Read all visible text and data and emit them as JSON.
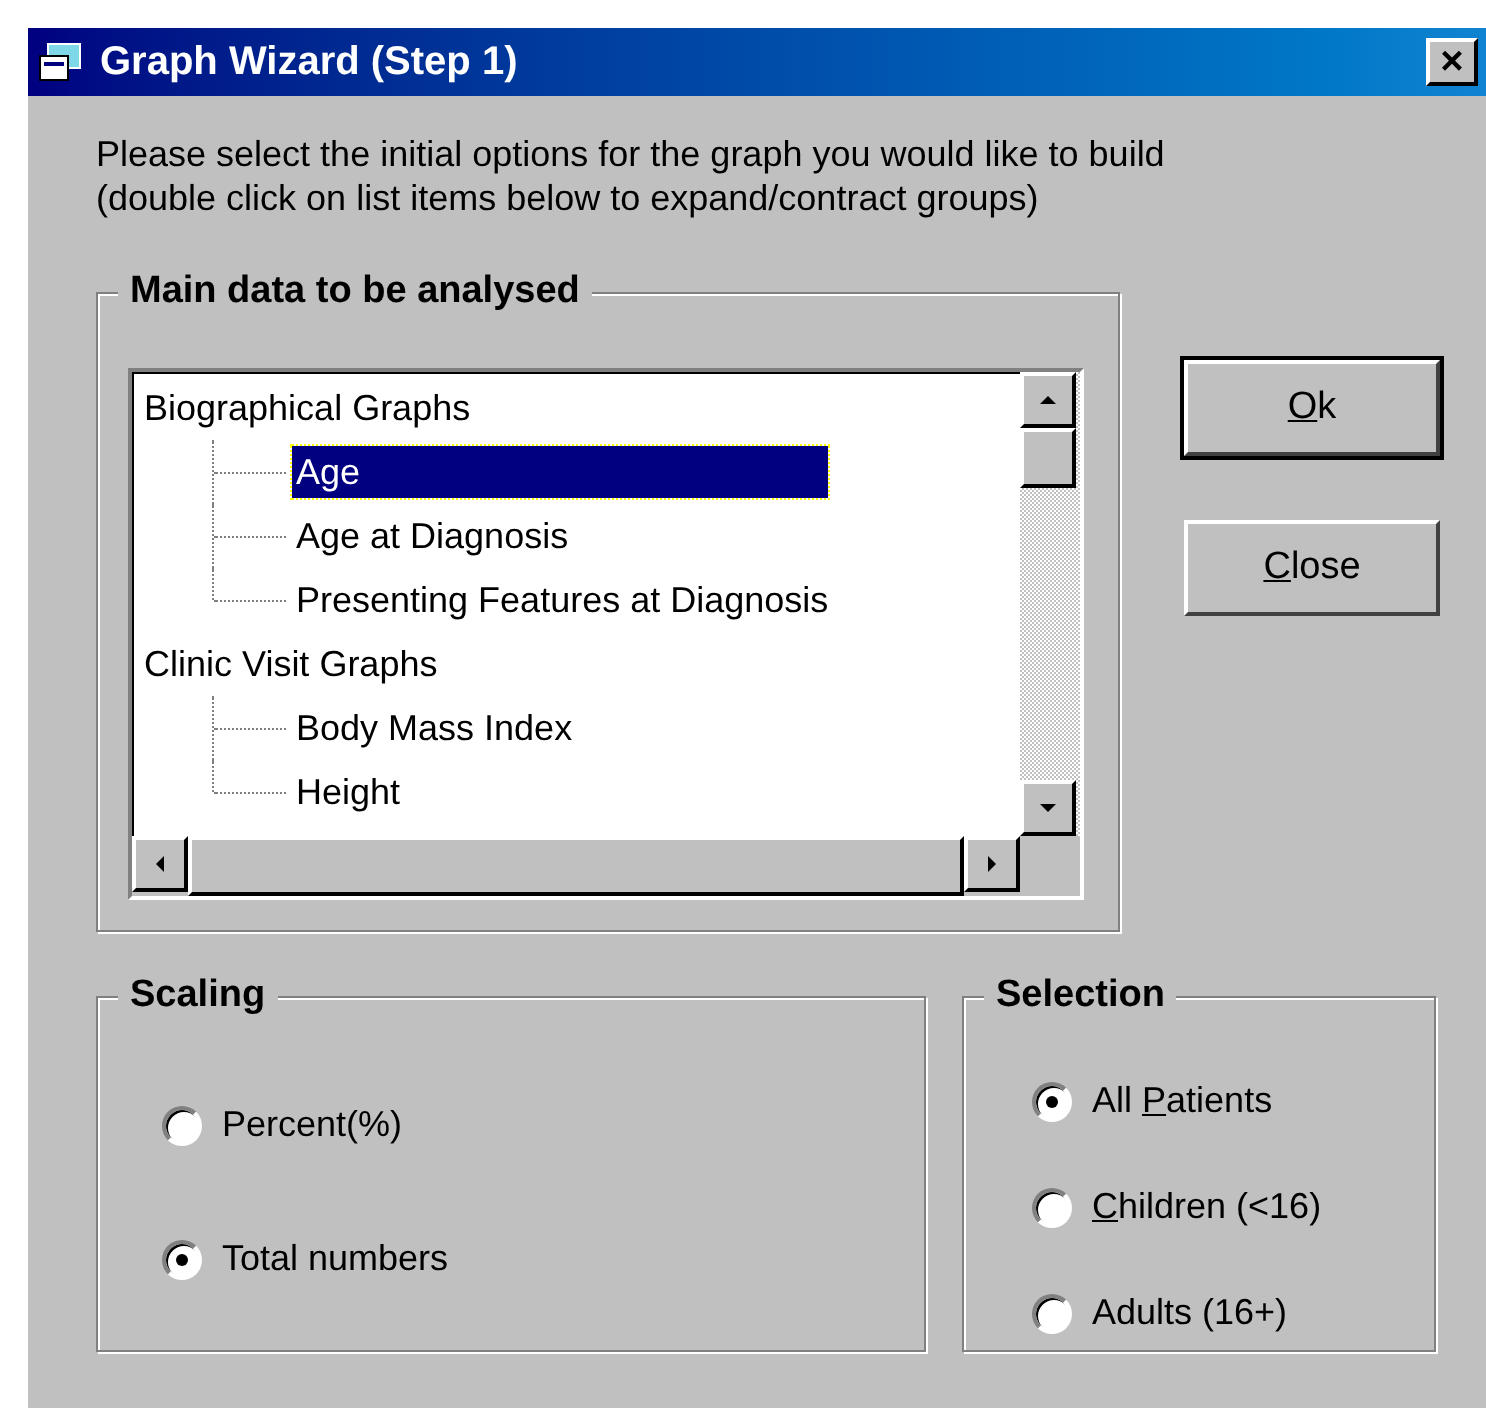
{
  "window": {
    "title": "Graph Wizard (Step 1)",
    "close_glyph": "×"
  },
  "instructions": [
    "Please select the initial options for the graph you would like to build",
    "(double click on list items below to expand/contract groups)"
  ],
  "main_data": {
    "title": "Main data to be analysed",
    "groups": [
      {
        "label": "Biographical Graphs",
        "children": [
          {
            "label": "Age",
            "selected": true
          },
          {
            "label": "Age at Diagnosis",
            "selected": false
          },
          {
            "label": "Presenting Features at Diagnosis",
            "selected": false
          }
        ]
      },
      {
        "label": "Clinic Visit Graphs",
        "children": [
          {
            "label": "Body Mass Index",
            "selected": false
          },
          {
            "label": "Height",
            "selected": false
          }
        ]
      }
    ]
  },
  "buttons": [
    {
      "key": "O",
      "post": "k",
      "default": true
    },
    {
      "key": "C",
      "post": "lose",
      "default": false
    }
  ],
  "scaling": {
    "title": "Scaling",
    "options": [
      {
        "pre": "Percent(%)",
        "selected": false
      },
      {
        "pre": "Total numbers",
        "selected": true
      }
    ]
  },
  "selection": {
    "title": "Selection",
    "options": [
      {
        "pre": "All ",
        "key": "P",
        "post": "atients",
        "selected": true
      },
      {
        "key": "C",
        "post": "hildren (<16)",
        "selected": false
      },
      {
        "pre": "Adults (16+)",
        "selected": false
      }
    ]
  }
}
